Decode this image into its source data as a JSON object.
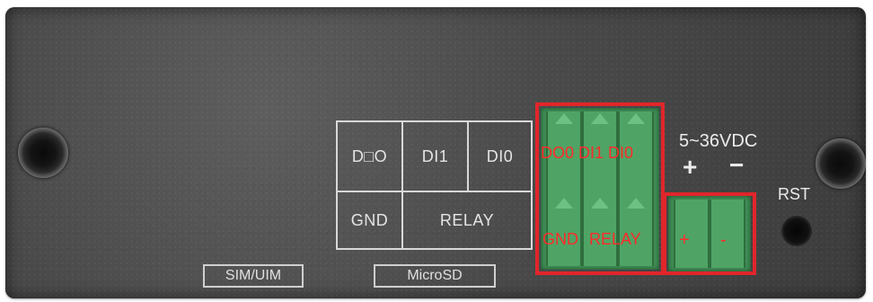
{
  "labels": {
    "d00": "D□O",
    "di1": "DI1",
    "di0": "DI0",
    "gnd": "GND",
    "relay": "RELAY",
    "sim": "SIM/UIM",
    "microsd": "MicroSD",
    "power": "5~36VDC",
    "plus": "+",
    "minus": "−",
    "rst": "RST"
  },
  "annotations": {
    "top_row": "DO0 DI1 DI0",
    "gnd": "GND",
    "relay": "RELAY",
    "plus": "+",
    "minus": "-"
  },
  "colors": {
    "panel": "#4a4a4a",
    "terminal": "#4fa465",
    "highlight": "#e0262b",
    "label_border": "#d8d8d8"
  }
}
